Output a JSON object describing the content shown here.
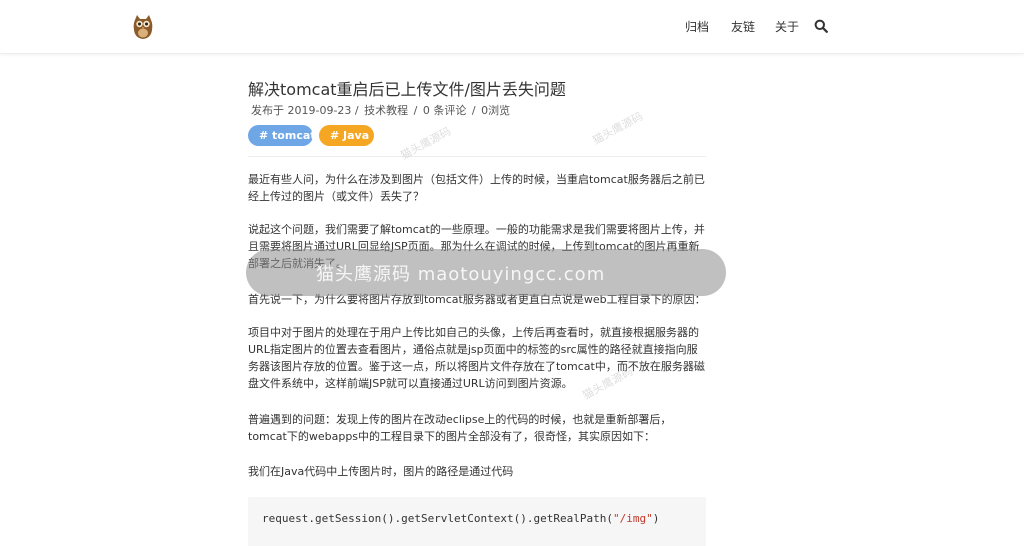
{
  "header": {
    "logo_icon": "owl-logo",
    "nav": [
      "归档",
      "友链",
      "关于"
    ],
    "search_icon": "search-icon"
  },
  "post": {
    "title": "解决tomcat重启后已上传文件/图片丢失问题",
    "meta": {
      "date": "发布于 2019-09-23 /",
      "category": "技术教程",
      "sep1": "/",
      "comments": "0 条评论",
      "sep2": "/",
      "views": "0浏览"
    },
    "tags": [
      "# tomcat",
      "# Java"
    ],
    "paragraphs": [
      "最近有些人问，为什么在涉及到图片（包括文件）上传的时候，当重启tomcat服务器后之前已经上传过的图片（或文件）丢失了？",
      "说起这个问题，我们需要了解tomcat的一些原理。一般的功能需求是我们需要将图片上传，并且需要将图片通过URL回显给JSP页面。那为什么在调试的时候，上传到tomcat的图片再重新部署之后就消失了。",
      "首先说一下，为什么要将图片存放到tomcat服务器或者更直白点说是web工程目录下的原因：",
      "项目中对于图片的处理在于用户上传比如自己的头像，上传后再查看时，就直接根据服务器的URL指定图片的位置去查看图片，通俗点就是jsp页面中的标签的src属性的路径就直接指向服务器该图片存放的位置。鉴于这一点，所以将图片文件存放在了tomcat中，而不放在服务器磁盘文件系统中，这样前端JSP就可以直接通过URL访问到图片资源。",
      "普遍遇到的问题：发现上传的图片在改动eclipse上的代码的时候，也就是重新部署后，tomcat下的webapps中的工程目录下的图片全部没有了，很奇怪，其实原因如下：",
      "我们在Java代码中上传图片时，图片的路径是通过代码"
    ],
    "code": {
      "prefix": "request.getSession().getServletContext().getRealPath(",
      "string": "\"/img\"",
      "suffix": ")"
    }
  },
  "watermark": {
    "band": "猫头鹰源码 maotouyingcc.com",
    "small": "猫头鹰源码"
  }
}
